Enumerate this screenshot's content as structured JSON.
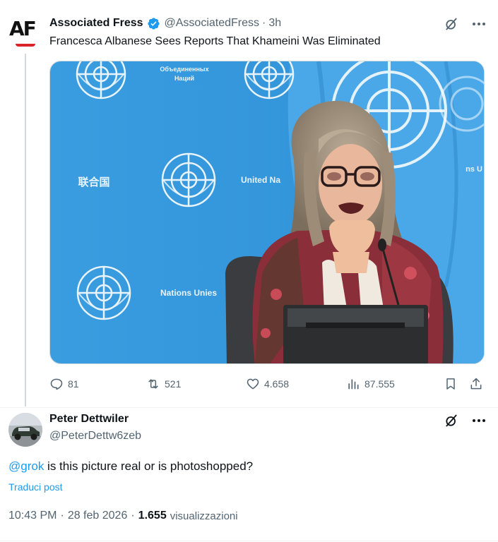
{
  "post": {
    "author_name": "Associated Fress",
    "author_handle": "@AssociatedFress",
    "separator": "·",
    "time": "3h",
    "avatar_text": "AF",
    "text": "Francesca Albanese Sees Reports That Khameini Was Eliminated",
    "media_signs": {
      "top": "Объединенных\nНаций",
      "chinese": "联合国",
      "english": "United Na",
      "french": "Nations Unies",
      "right": "ns U"
    },
    "stats": {
      "replies": "81",
      "reposts": "521",
      "likes": "4.658",
      "views": "87.555"
    }
  },
  "reply": {
    "author_name": "Peter Dettwiler",
    "author_handle": "@PeterDettw6zeb",
    "mention": "@grok",
    "text": " is this picture real or is photoshopped?",
    "translate_label": "Traduci post",
    "time": "10:43 PM",
    "separator1": "·",
    "date": "28 feb 2026",
    "separator2": "·",
    "views_count": "1.655",
    "views_label": "visualizzazioni"
  },
  "colors": {
    "accent": "#1d9bf0",
    "secondary_text": "#536471",
    "un_blue": "#3aa3e3"
  }
}
